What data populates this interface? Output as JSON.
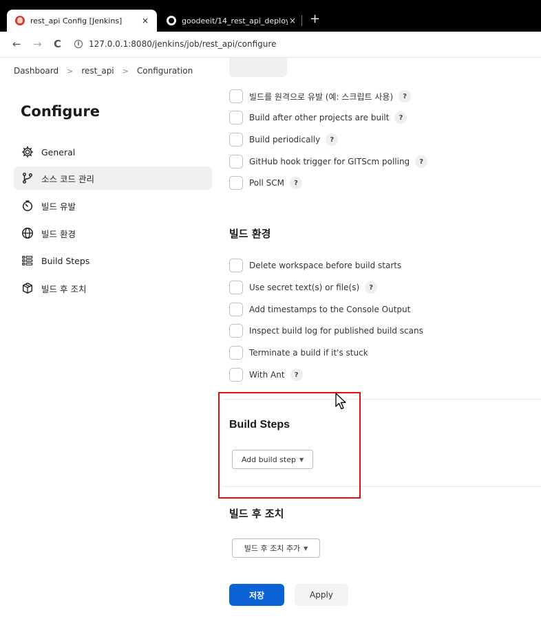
{
  "browser": {
    "tabs": [
      {
        "title": "rest_api Config [Jenkins]",
        "favicon": "jenkins-icon",
        "active": true,
        "close": "×"
      },
      {
        "title": "goodeeit/14_rest_api_deploy",
        "favicon": "github-icon",
        "active": false,
        "close": "×"
      }
    ],
    "new_tab": "+",
    "nav": {
      "back": "←",
      "forward": "→",
      "reload": "C"
    },
    "url": "127.0.0.1:8080/jenkins/job/rest_api/configure"
  },
  "breadcrumb": [
    "Dashboard",
    "rest_api",
    "Configuration"
  ],
  "breadcrumb_sep": ">",
  "sidebar": {
    "title": "Configure",
    "items": [
      {
        "label": "General",
        "icon": "gear-icon",
        "active": false
      },
      {
        "label": "소스 코드 관리",
        "icon": "branch-icon",
        "active": true
      },
      {
        "label": "빌드 유발",
        "icon": "timer-icon",
        "active": false
      },
      {
        "label": "빌드 환경",
        "icon": "globe-icon",
        "active": false
      },
      {
        "label": "Build Steps",
        "icon": "list-icon",
        "active": false
      },
      {
        "label": "빌드 후 조치",
        "icon": "box-icon",
        "active": false
      }
    ]
  },
  "triggers": [
    {
      "label": "빌드를 원격으로 유발 (예: 스크립트 사용)",
      "help": true
    },
    {
      "label": "Build after other projects are built",
      "help": true
    },
    {
      "label": "Build periodically",
      "help": true
    },
    {
      "label": "GitHub hook trigger for GITScm polling",
      "help": true
    },
    {
      "label": "Poll SCM",
      "help": true
    }
  ],
  "build_env": {
    "title": "빌드 환경",
    "options": [
      {
        "label": "Delete workspace before build starts",
        "help": false
      },
      {
        "label": "Use secret text(s) or file(s)",
        "help": true
      },
      {
        "label": "Add timestamps to the Console Output",
        "help": false
      },
      {
        "label": "Inspect build log for published build scans",
        "help": false
      },
      {
        "label": "Terminate a build if it's stuck",
        "help": false
      },
      {
        "label": "With Ant",
        "help": true
      }
    ]
  },
  "build_steps": {
    "title": "Build Steps",
    "button": "Add build step"
  },
  "post_build": {
    "title": "빌드 후 조치",
    "button": "빌드 후 조치 추가"
  },
  "help_glyph": "?",
  "actions": {
    "save": "저장",
    "apply": "Apply"
  },
  "colors": {
    "primary": "#0b63d6",
    "highlight": "#e01010"
  }
}
